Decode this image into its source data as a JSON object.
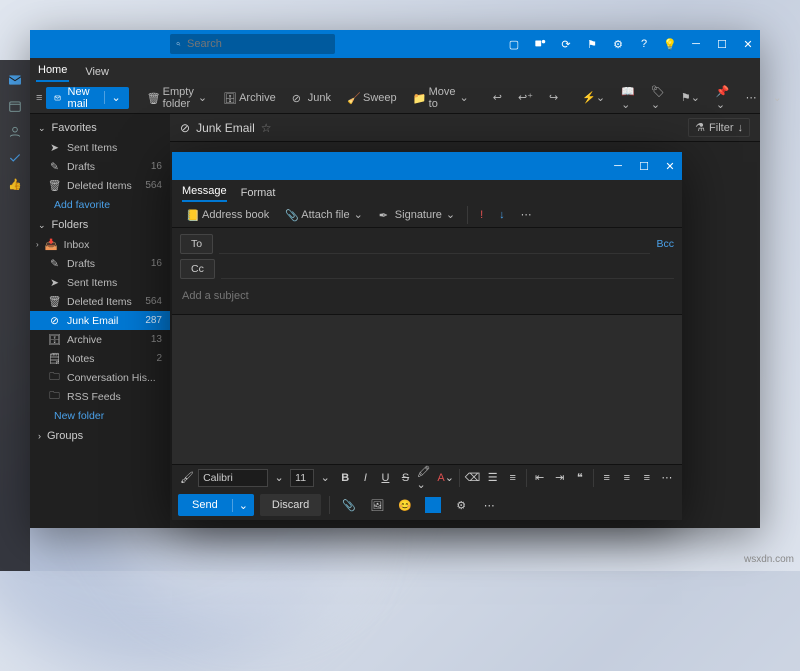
{
  "attribution": "wsxdn.com",
  "main": {
    "search_placeholder": "Search",
    "tabs": {
      "home": "Home",
      "view": "View"
    },
    "new_mail": "New mail",
    "toolbar": {
      "empty": "Empty folder",
      "archive": "Archive",
      "junk": "Junk",
      "sweep": "Sweep",
      "moveto": "Move to"
    },
    "list_header": {
      "title": "Junk Email",
      "filter": "Filter"
    }
  },
  "sidebar": {
    "favorites": "Favorites",
    "folders": "Folders",
    "groups": "Groups",
    "add_fav": "Add favorite",
    "new_folder": "New folder",
    "fav": [
      {
        "label": "Sent Items",
        "count": ""
      },
      {
        "label": "Drafts",
        "count": "16"
      },
      {
        "label": "Deleted Items",
        "count": "564"
      }
    ],
    "fold": [
      {
        "label": "Inbox",
        "count": ""
      },
      {
        "label": "Drafts",
        "count": "16"
      },
      {
        "label": "Sent Items",
        "count": ""
      },
      {
        "label": "Deleted Items",
        "count": "564"
      },
      {
        "label": "Junk Email",
        "count": "287"
      },
      {
        "label": "Archive",
        "count": "13"
      },
      {
        "label": "Notes",
        "count": "2"
      },
      {
        "label": "Conversation His...",
        "count": ""
      },
      {
        "label": "RSS Feeds",
        "count": ""
      }
    ]
  },
  "compose": {
    "tabs": {
      "message": "Message",
      "format": "Format"
    },
    "toolbar": {
      "addr": "Address book",
      "attach": "Attach file",
      "sig": "Signature"
    },
    "fields": {
      "to": "To",
      "cc": "Cc",
      "bcc": "Bcc",
      "subject_ph": "Add a subject"
    },
    "format": {
      "font": "Calibri",
      "size": "11"
    },
    "send": "Send",
    "discard": "Discard"
  }
}
